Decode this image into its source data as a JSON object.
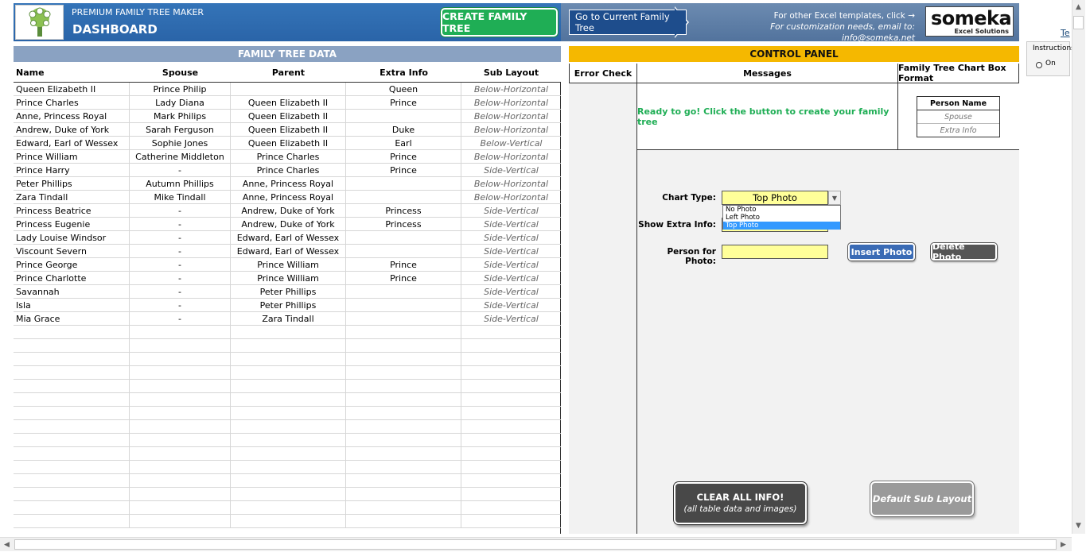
{
  "header": {
    "app_subtitle": "PREMIUM FAMILY TREE MAKER",
    "app_title": "DASHBOARD",
    "create_button": "CREATE FAMILY TREE",
    "goto_button": "Go to Current Family Tree",
    "templates_line": "For other Excel templates, click →",
    "customization_line": "For customization needs, email to: info@someka.net",
    "brand_name": "someka",
    "brand_sub": "Excel Solutions",
    "side_link_fragment": "Te",
    "instructions_label": "Instructions",
    "instructions_option": "On"
  },
  "colors": {
    "header_blue": "#2b6cb0",
    "create_green": "#1fae55",
    "control_panel_yellow": "#f5b800",
    "message_green": "#1fae55",
    "input_yellow": "#ffff99"
  },
  "table": {
    "title": "FAMILY TREE DATA",
    "columns": [
      "Name",
      "Spouse",
      "Parent",
      "Extra Info",
      "Sub Layout"
    ],
    "rows": [
      [
        "Queen Elizabeth II",
        "Prince Philip",
        "",
        "Queen",
        "Below-Horizontal"
      ],
      [
        "Prince Charles",
        "Lady Diana",
        "Queen Elizabeth II",
        "Prince",
        "Below-Horizontal"
      ],
      [
        "Anne, Princess Royal",
        "Mark Philips",
        "Queen Elizabeth II",
        "",
        "Below-Horizontal"
      ],
      [
        "Andrew, Duke of York",
        "Sarah Ferguson",
        "Queen Elizabeth II",
        "Duke",
        "Below-Horizontal"
      ],
      [
        "Edward, Earl of Wessex",
        "Sophie Jones",
        "Queen Elizabeth II",
        "Earl",
        "Below-Vertical"
      ],
      [
        "Prince William",
        "Catherine Middleton",
        "Prince Charles",
        "Prince",
        "Below-Horizontal"
      ],
      [
        "Prince Harry",
        "-",
        "Prince Charles",
        "Prince",
        "Side-Vertical"
      ],
      [
        "Peter Phillips",
        "Autumn Phillips",
        "Anne, Princess Royal",
        "",
        "Below-Horizontal"
      ],
      [
        "Zara Tindall",
        "Mike Tindall",
        "Anne, Princess Royal",
        "",
        "Below-Horizontal"
      ],
      [
        "Princess Beatrice",
        "-",
        "Andrew, Duke of York",
        "Princess",
        "Side-Vertical"
      ],
      [
        "Princess Eugenie",
        "-",
        "Andrew, Duke of York",
        "Princess",
        "Side-Vertical"
      ],
      [
        "Lady Louise Windsor",
        "-",
        "Edward, Earl of Wessex",
        "",
        "Side-Vertical"
      ],
      [
        "Viscount Severn",
        "-",
        "Edward, Earl of Wessex",
        "",
        "Side-Vertical"
      ],
      [
        "Prince George",
        "-",
        "Prince William",
        "Prince",
        "Side-Vertical"
      ],
      [
        "Prince Charlotte",
        "-",
        "Prince William",
        "Prince",
        "Side-Vertical"
      ],
      [
        "Savannah",
        "-",
        "Peter Phillips",
        "",
        "Side-Vertical"
      ],
      [
        "Isla",
        "-",
        "Peter Phillips",
        "",
        "Side-Vertical"
      ],
      [
        "Mia Grace",
        "-",
        "Zara Tindall",
        "",
        "Side-Vertical"
      ]
    ],
    "empty_rows": 15
  },
  "control_panel": {
    "title": "CONTROL PANEL",
    "col_error": "Error Check",
    "col_messages": "Messages",
    "col_format": "Family Tree Chart Box Format",
    "message": "Ready to go! Click the button to create your family tree",
    "format_card": {
      "name": "Person Name",
      "spouse": "Spouse",
      "extra": "Extra Info"
    },
    "chart_type_label": "Chart Type:",
    "chart_type_value": "Top Photo",
    "chart_type_options": [
      "No Photo",
      "Left Photo",
      "Top Photo"
    ],
    "show_extra_label": "Show Extra Info:",
    "show_extra_value": "",
    "person_photo_label": "Person for Photo:",
    "person_photo_value": "",
    "insert_photo": "Insert Photo",
    "delete_photo": "Delete Photo",
    "clear_title": "CLEAR ALL INFO!",
    "clear_sub": "(all table data and images)",
    "default_layout": "Default Sub Layout"
  }
}
